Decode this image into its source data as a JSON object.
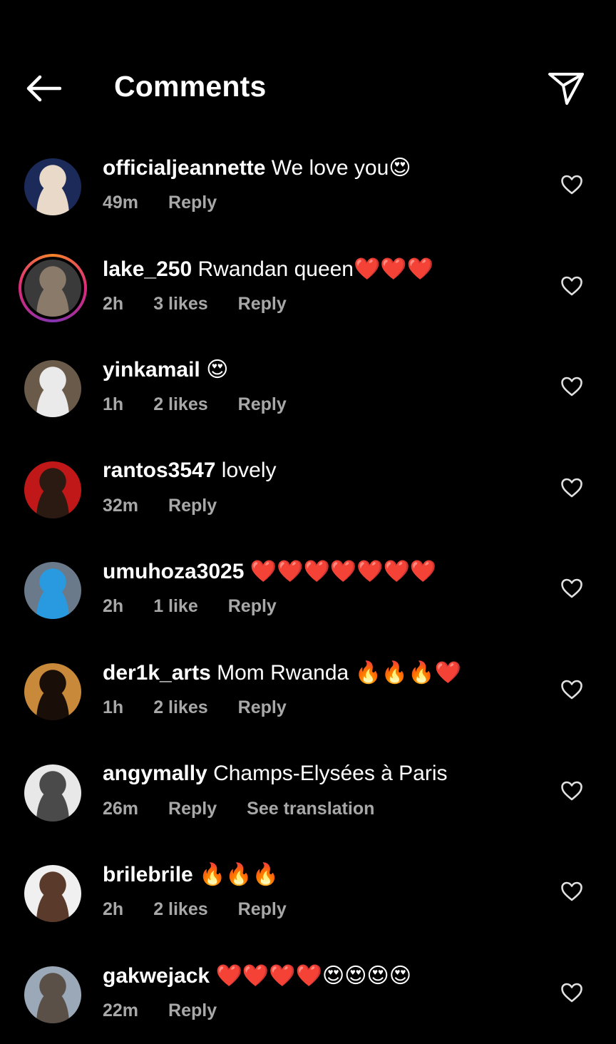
{
  "header": {
    "title": "Comments",
    "back_icon": "arrow-left-icon",
    "share_icon": "paper-plane-icon"
  },
  "comments": [
    {
      "username": "officialjeannette",
      "text": "We love you😍",
      "time": "49m",
      "likes": "",
      "reply": "Reply",
      "extra": "",
      "avatar_colors": [
        "#1c2a5a",
        "#e8d9c8"
      ],
      "story_ring": false
    },
    {
      "username": "lake_250",
      "text": "Rwandan queen❤️❤️❤️",
      "time": "2h",
      "likes": "3 likes",
      "reply": "Reply",
      "extra": "",
      "avatar_colors": [
        "#3a3a3a",
        "#8a7a6a"
      ],
      "story_ring": true
    },
    {
      "username": "yinkamail",
      "text": "😍",
      "time": "1h",
      "likes": "2 likes",
      "reply": "Reply",
      "extra": "",
      "avatar_colors": [
        "#6a5a4a",
        "#eaeaea"
      ],
      "story_ring": false
    },
    {
      "username": "rantos3547",
      "text": "lovely",
      "time": "32m",
      "likes": "",
      "reply": "Reply",
      "extra": "",
      "avatar_colors": [
        "#c01818",
        "#2a1a12"
      ],
      "story_ring": false
    },
    {
      "username": "umuhoza3025",
      "text": "❤️❤️❤️❤️❤️❤️❤️",
      "time": "2h",
      "likes": "1 like",
      "reply": "Reply",
      "extra": "",
      "avatar_colors": [
        "#6a7a8a",
        "#2a9ae0"
      ],
      "story_ring": false
    },
    {
      "username": "der1k_arts",
      "text": "Mom Rwanda 🔥🔥🔥❤️",
      "time": "1h",
      "likes": "2 likes",
      "reply": "Reply",
      "extra": "",
      "avatar_colors": [
        "#c88a3a",
        "#1a0e08"
      ],
      "story_ring": false
    },
    {
      "username": "angymally",
      "text": "Champs-Elysées à Paris",
      "time": "26m",
      "likes": "",
      "reply": "Reply",
      "extra": "See translation",
      "avatar_colors": [
        "#e8e8e8",
        "#4a4a4a"
      ],
      "story_ring": false
    },
    {
      "username": "brilebrile",
      "text": "🔥🔥🔥",
      "time": "2h",
      "likes": "2 likes",
      "reply": "Reply",
      "extra": "",
      "avatar_colors": [
        "#f0f0f0",
        "#5a3a2a"
      ],
      "story_ring": false
    },
    {
      "username": "gakwejack",
      "text": "❤️❤️❤️❤️😍😍😍😍",
      "time": "22m",
      "likes": "",
      "reply": "Reply",
      "extra": "",
      "avatar_colors": [
        "#9aa8b8",
        "#5a5048"
      ],
      "story_ring": false
    }
  ]
}
